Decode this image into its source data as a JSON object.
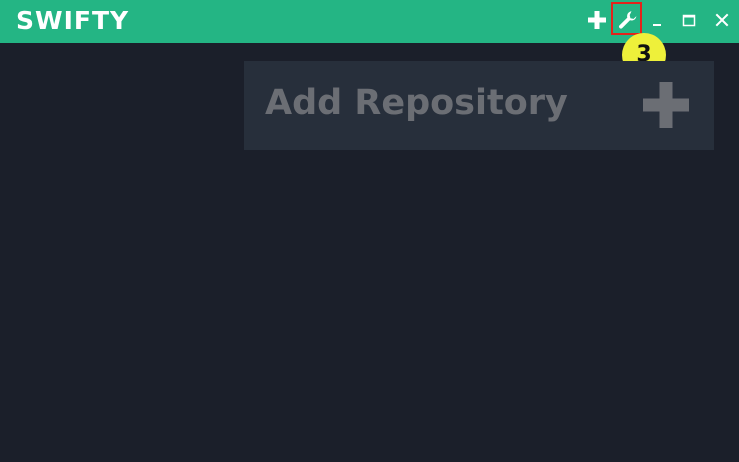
{
  "app": {
    "title": "SWIFTY"
  },
  "titlebar": {
    "buttons": [
      {
        "icon": "plus-icon"
      },
      {
        "icon": "wrench-icon"
      },
      {
        "icon": "minimize-icon"
      },
      {
        "icon": "maximize-icon"
      },
      {
        "icon": "close-icon"
      }
    ]
  },
  "annotation": {
    "step_number": "3"
  },
  "main": {
    "add_repository_label": "Add Repository",
    "add_repository_icon": "plus-icon"
  },
  "colors": {
    "titlebar": "#24b584",
    "background": "#1b1f2a",
    "card": "#272f3b",
    "card_text": "#6b6e74",
    "highlight": "#e3231b",
    "marker": "#eef03a"
  }
}
